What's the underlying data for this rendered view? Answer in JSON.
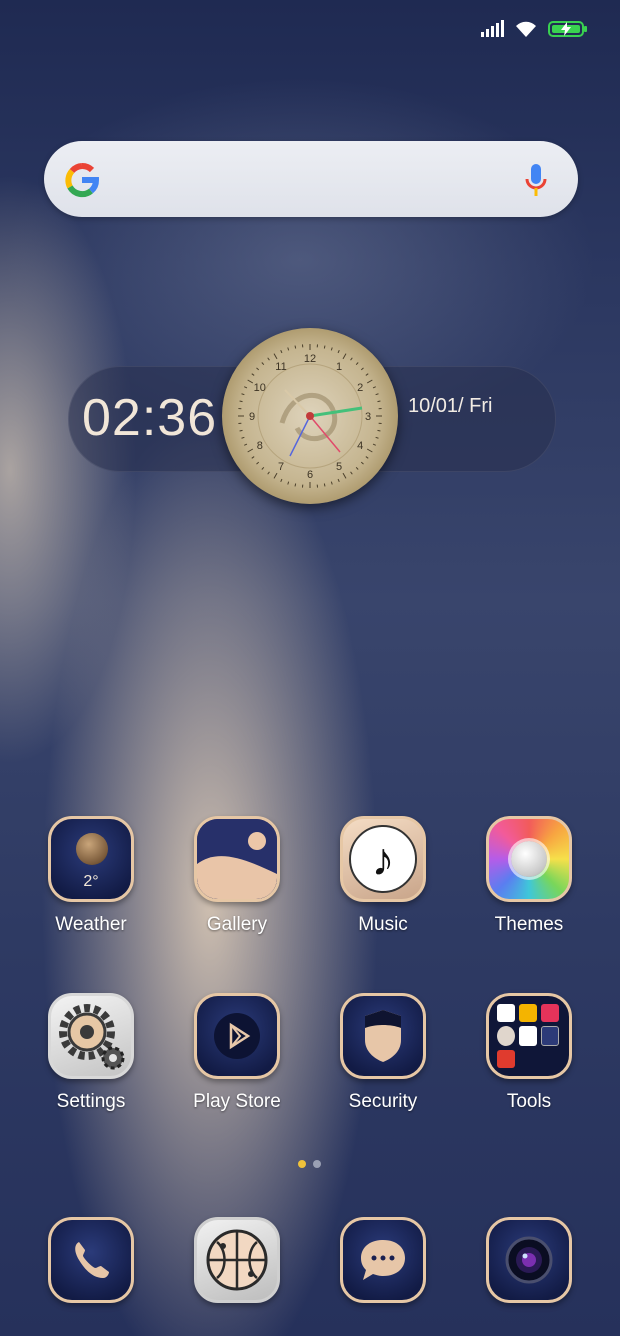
{
  "status": {
    "icons": [
      "signal-icon",
      "wifi-icon",
      "battery-charging-icon"
    ],
    "battery_color": "#39d150"
  },
  "search": {
    "left_icon": "google-logo-icon",
    "right_icon": "microphone-icon"
  },
  "clock": {
    "time": "02:36",
    "date": "10/01/ Fri",
    "dial_numbers": [
      "12",
      "1",
      "2",
      "3",
      "4",
      "5",
      "6",
      "7",
      "8",
      "9",
      "10",
      "11"
    ]
  },
  "apps": [
    {
      "label": "Weather",
      "icon": "weather-moon-icon",
      "temp": "2°"
    },
    {
      "label": "Gallery",
      "icon": "gallery-dunes-icon"
    },
    {
      "label": "Music",
      "icon": "music-note-icon"
    },
    {
      "label": "Themes",
      "icon": "themes-palette-icon"
    },
    {
      "label": "Settings",
      "icon": "gear-icon"
    },
    {
      "label": "Play Store",
      "icon": "play-store-icon"
    },
    {
      "label": "Security",
      "icon": "shield-icon"
    },
    {
      "label": "Tools",
      "icon": "folder-tools-icon"
    }
  ],
  "pager": {
    "pages": 2,
    "active": 1,
    "active_color": "#f0c23a",
    "inactive_color": "#9aa0b4"
  },
  "dock": [
    {
      "icon": "phone-icon"
    },
    {
      "icon": "browser-globe-icon"
    },
    {
      "icon": "messaging-icon"
    },
    {
      "icon": "camera-icon"
    }
  ]
}
